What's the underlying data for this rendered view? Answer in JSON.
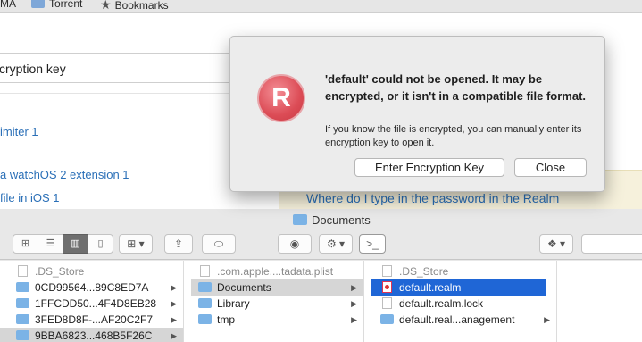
{
  "bookmarks_bar": {
    "items": [
      {
        "label": "MA"
      },
      {
        "label": "Torrent"
      },
      {
        "label": "Bookmarks"
      }
    ]
  },
  "webpage": {
    "search_text": "cryption key",
    "links": [
      "imiter 1",
      "a watchOS 2 extension 1",
      "file in iOS 1"
    ],
    "box_link": "Where do I type in the password in the Realm"
  },
  "dialog": {
    "app_icon_letter": "R",
    "title": "'default' could not be opened. It may be encrypted, or it isn't in a compatible file format.",
    "body": "If you know the file is encrypted, you can manually enter its encryption key to open it.",
    "enter_key_label": "Enter Encryption Key",
    "close_label": "Close",
    "accent_color": "#dc4c56"
  },
  "finder": {
    "title": "Documents",
    "columns": [
      {
        "rows": [
          {
            "name": ".DS_Store",
            "kind": "doc",
            "state": "dim"
          },
          {
            "name": "0CD99564...89C8ED7A",
            "kind": "folder",
            "chevron": true
          },
          {
            "name": "1FFCDD50...4F4D8EB28",
            "kind": "folder",
            "chevron": true
          },
          {
            "name": "3FED8D8F-...AF20C2F7",
            "kind": "folder",
            "chevron": true
          },
          {
            "name": "9BBA6823...468B5F26C",
            "kind": "folder",
            "chevron": true,
            "state": "selected-gray"
          }
        ]
      },
      {
        "rows": [
          {
            "name": ".com.apple....tadata.plist",
            "kind": "doc",
            "state": "dim"
          },
          {
            "name": "Documents",
            "kind": "folder",
            "chevron": true,
            "state": "selected-gray"
          },
          {
            "name": "Library",
            "kind": "folder",
            "chevron": true
          },
          {
            "name": "tmp",
            "kind": "folder",
            "chevron": true
          }
        ]
      },
      {
        "rows": [
          {
            "name": ".DS_Store",
            "kind": "doc",
            "state": "dim"
          },
          {
            "name": "default.realm",
            "kind": "realm",
            "state": "selected-blue"
          },
          {
            "name": "default.realm.lock",
            "kind": "doc"
          },
          {
            "name": "default.real...anagement",
            "kind": "folder",
            "chevron": true
          }
        ]
      }
    ],
    "selection_color": "#1f66d6"
  }
}
